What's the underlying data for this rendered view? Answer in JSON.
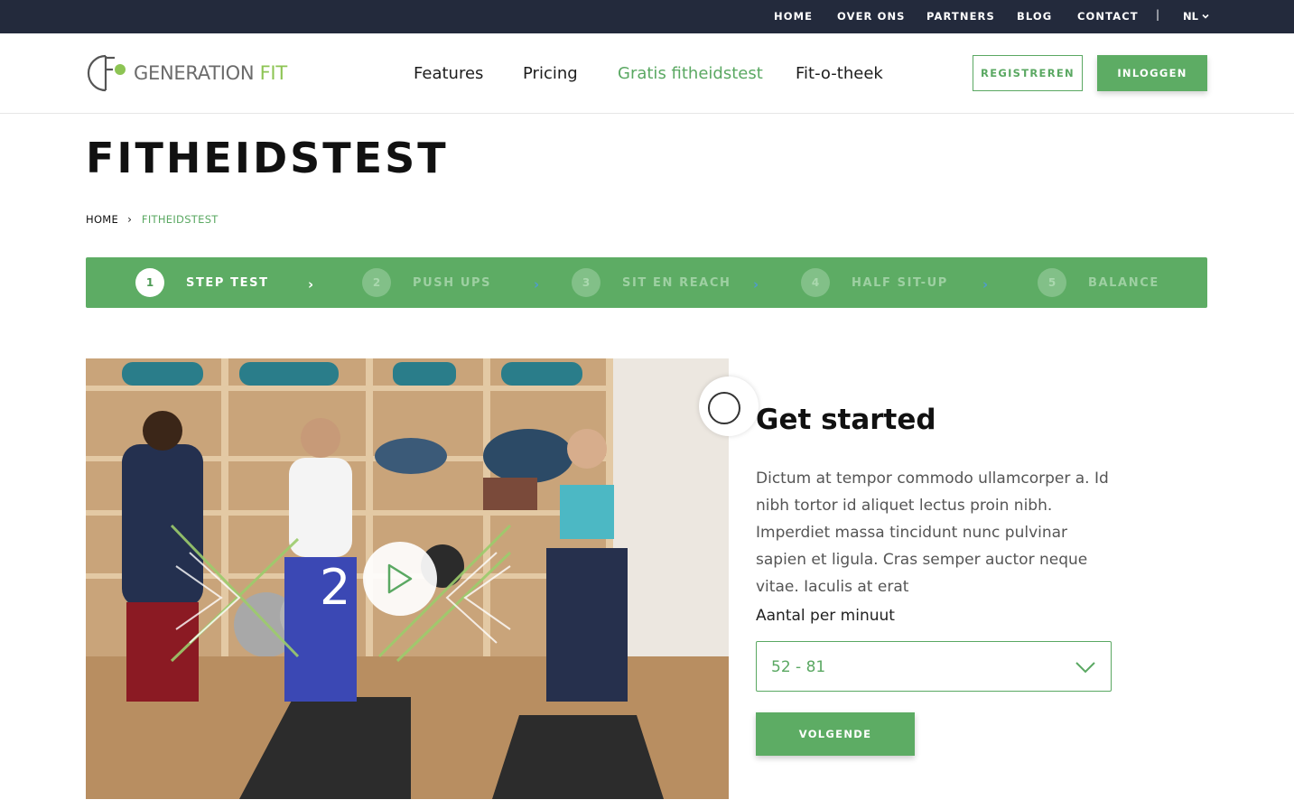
{
  "topbar": {
    "links": [
      "HOME",
      "OVER ONS",
      "PARTNERS",
      "BLOG",
      "CONTACT"
    ],
    "separator": "|",
    "language": "NL"
  },
  "header": {
    "logo_text": "GENERATION",
    "logo_text_accent": "FIT",
    "nav": [
      "Features",
      "Pricing",
      "Gratis fitheidstest",
      "Fit-o-theek"
    ],
    "active_nav": "Gratis fitheidstest",
    "register_label": "REGISTREREN",
    "login_label": "INLOGGEN"
  },
  "page": {
    "title": "FITHEIDSTEST",
    "breadcrumb": {
      "home": "HOME",
      "current": "FITHEIDSTEST"
    }
  },
  "steps": [
    {
      "num": "1",
      "label": "STEP TEST",
      "state": "active"
    },
    {
      "num": "2",
      "label": "PUSH UPS",
      "state": "inactive"
    },
    {
      "num": "3",
      "label": "SIT EN REACH",
      "state": "inactive"
    },
    {
      "num": "4",
      "label": "HALF SIT-UP",
      "state": "inactive"
    },
    {
      "num": "5",
      "label": "BALANCE",
      "state": "inactive"
    }
  ],
  "video": {
    "counter": "2"
  },
  "panel": {
    "title": "Get started",
    "body": "Dictum at tempor commodo ullamcorper a. Id nibh tortor id aliquet lectus proin nibh. Imperdiet massa tincidunt nunc pulvinar sapien et ligula. Cras semper auctor neque vitae. Iaculis at erat",
    "field_label": "Aantal per minuut",
    "select_value": "52 - 81",
    "next_label": "VOLGENDE"
  },
  "colors": {
    "brand_green": "#5dac64",
    "topbar": "#232a3c",
    "accent_lime": "#8dc454"
  }
}
